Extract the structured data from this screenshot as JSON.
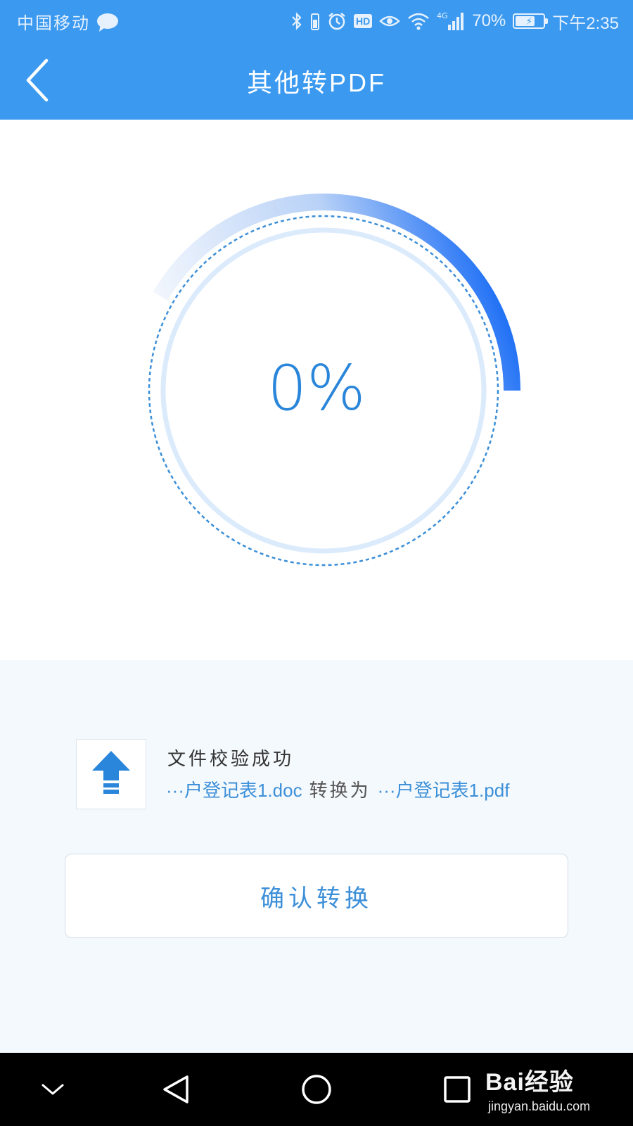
{
  "status_bar": {
    "carrier": "中国移动",
    "network": "4G",
    "battery_percent": "70%",
    "time": "下午2:35",
    "battery_level": 0.7
  },
  "app_bar": {
    "title": "其他转PDF"
  },
  "progress": {
    "percent_text": "0%",
    "arc_level": 0.25,
    "colors": {
      "arc_start": "#dbe8fb",
      "arc_end": "#0b63f5",
      "ring": "#dbebfc",
      "dashed": "#3c8fd8"
    }
  },
  "file": {
    "status": "文件校验成功",
    "source": "···户登记表1.doc",
    "convert_word": "转换为",
    "target": "···户登记表1.pdf",
    "icon": "upload-arrow-icon"
  },
  "confirm_button": {
    "label": "确认转换"
  },
  "watermark": {
    "logo": "Bai经验",
    "url": "jingyan.baidu.com"
  },
  "colors": {
    "primary": "#3b9af0",
    "accent_text": "#3c8fd8",
    "info_bg": "#f4f9fd"
  }
}
